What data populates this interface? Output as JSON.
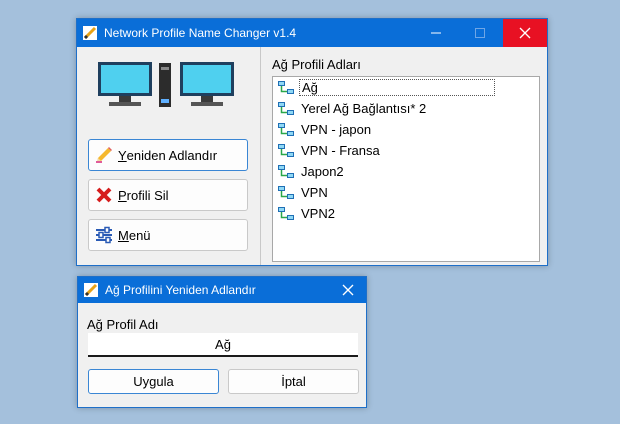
{
  "main_window": {
    "title": "Network Profile Name Changer v1.4",
    "buttons": {
      "rename": {
        "first": "Y",
        "rest": "eniden Adlandır"
      },
      "delete": {
        "first": "P",
        "rest": "rofili Sil"
      },
      "menu": {
        "first": "M",
        "rest": "enü"
      }
    },
    "list_label": "Ağ Profili Adları",
    "profiles": [
      "Ağ",
      "Yerel Ağ Bağlantısı* 2",
      "VPN - japon",
      "VPN - Fransa",
      "Japon2",
      "VPN",
      "VPN2"
    ],
    "selected_index": 0
  },
  "dialog": {
    "title": "Ağ Profilini Yeniden Adlandır",
    "field_label": "Ağ Profil Adı",
    "field_value": "Ağ",
    "apply_label": "Uygula",
    "cancel_label": "İptal"
  },
  "colors": {
    "titlebar": "#0a6ed8",
    "close_hover": "#e81123",
    "background": "#a4c0dc"
  }
}
